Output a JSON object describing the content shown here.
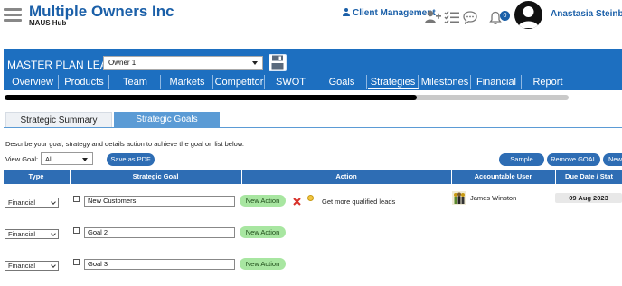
{
  "header": {
    "brand_title": "Multiple Owners Inc",
    "brand_subtitle": "MAUS Hub",
    "client_management": "Client Management",
    "notification_count": "0",
    "user_name": "Anastasia Steinbrun"
  },
  "plan": {
    "title": "MASTER PLAN LEAN",
    "owner_selected": "Owner 1"
  },
  "nav": {
    "tabs": [
      "Overview",
      "Products",
      "Team",
      "Markets",
      "Competitor",
      "SWOT",
      "Goals",
      "Strategies",
      "Milestones",
      "Financial",
      "Report"
    ],
    "active": "Strategies"
  },
  "progress": {
    "fraction": 0.73
  },
  "subtabs": {
    "summary": "Strategic Summary",
    "goals": "Strategic Goals"
  },
  "instructions": "Describe your goal, strategy and details action to achieve the goal on list below.",
  "view_goal": {
    "label": "View Goal:",
    "selected": "All"
  },
  "buttons": {
    "save_pdf": "Save as PDF",
    "sample": "Sample",
    "remove_goal": "Remove GOAL",
    "new": "New"
  },
  "table": {
    "headers": [
      "Type",
      "Strategic Goal",
      "Action",
      "Accountable User",
      "Due Date / Stat"
    ],
    "rows": [
      {
        "type": "Financial",
        "goal": "New Customers",
        "new_action": "New Action",
        "action_text": "Get more qualified leads",
        "user": "James Winston",
        "due": "09 Aug 2023"
      },
      {
        "type": "Financial",
        "goal": "Goal 2",
        "new_action": "New Action"
      },
      {
        "type": "Financial",
        "goal": "Goal 3",
        "new_action": "New Action"
      }
    ]
  }
}
